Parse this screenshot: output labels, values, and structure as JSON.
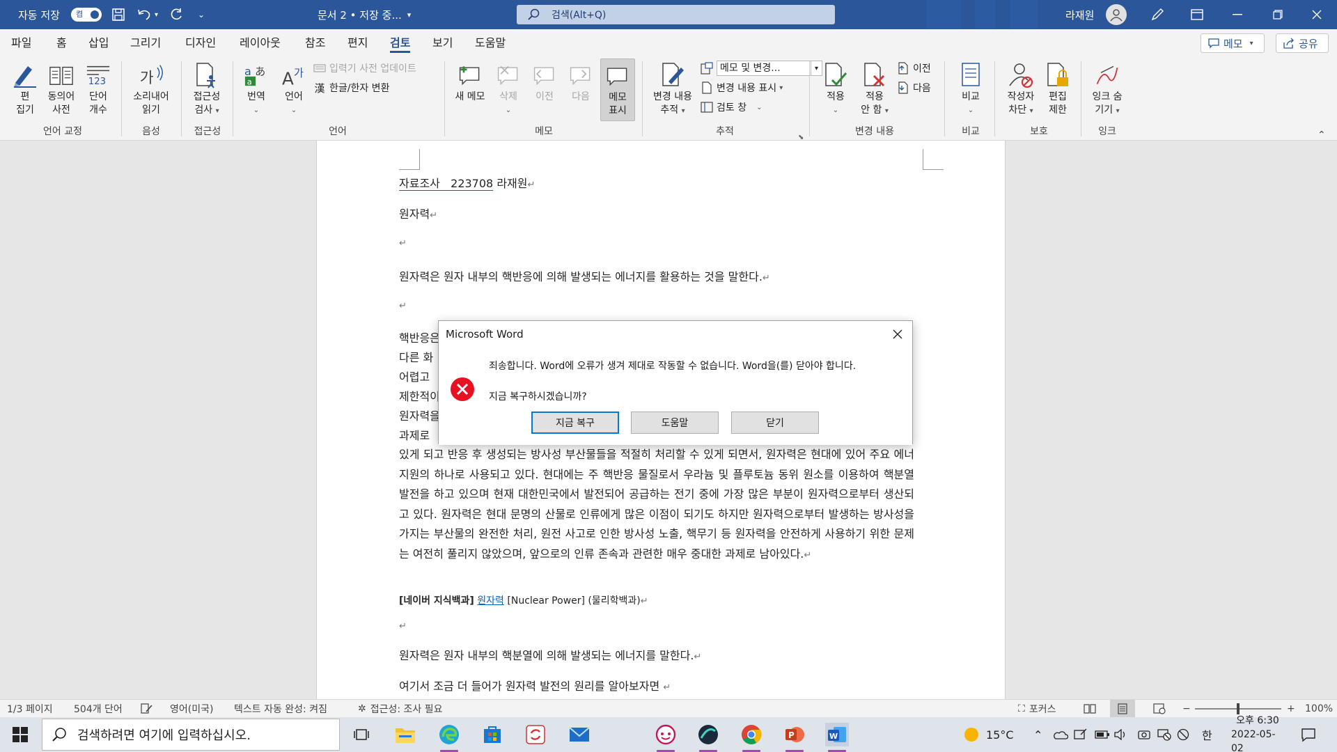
{
  "titlebar": {
    "autosave_label": "자동 저장",
    "autosave_state": "켬",
    "doc_title": "문서 2 • 저장 중...",
    "search_placeholder": "검색(Alt+Q)",
    "user_name": "라재원",
    "bg_color": "#2b579a"
  },
  "menu": {
    "tabs": [
      "파일",
      "홈",
      "삽입",
      "그리기",
      "디자인",
      "레이아웃",
      "참조",
      "편지",
      "검토",
      "보기",
      "도움말"
    ],
    "active_tab": "검토",
    "memo_button": "메모",
    "share_button": "공유"
  },
  "ribbon": {
    "edit_l1": "편",
    "edit_l2": "집기",
    "thesaurus_l1": "동의어",
    "thesaurus_l2": "사전",
    "wordcount_l1": "단어",
    "wordcount_l2": "개수",
    "readaloud_l1": "소리내어",
    "readaloud_l2": "읽기",
    "access_l1": "접근성",
    "access_l2": "검사",
    "translate": "번역",
    "language": "언어",
    "ime_update": "입력기 사전 업데이트",
    "hanja": "한글/한자 변환",
    "new_memo": "새 메모",
    "delete": "삭제",
    "prev": "이전",
    "next": "다음",
    "show_memo_l1": "메모",
    "show_memo_l2": "표시",
    "track_l1": "변경 내용",
    "track_l2": "추적",
    "markup_select": "메모 및 변경...",
    "show_markup": "변경 내용 표시",
    "review_pane": "검토 창",
    "accept_l1": "적용",
    "reject_l1": "적용",
    "reject_l2": "안 함",
    "change_prev": "이전",
    "change_next": "다음",
    "compare": "비교",
    "block_authors_l1": "작성자",
    "block_authors_l2": "차단",
    "restrict_l1": "편집",
    "restrict_l2": "제한",
    "ink_l1": "잉크 숨",
    "ink_l2": "기기",
    "groups": {
      "proofing": "언어 교정",
      "speech": "음성",
      "accessibility": "접근성",
      "language": "언어",
      "comments": "메모",
      "tracking": "추적",
      "changes": "변경 내용",
      "compare": "비교",
      "protect": "보호",
      "ink": "잉크"
    }
  },
  "document": {
    "header_line": "자료조사   223708",
    "header_name": "라재원",
    "title": "원자력",
    "p1": "원자력은 원자 내부의 핵반응에 의해 발생되는 에너지를 활용하는 것을 말한다.",
    "p2_visible": [
      "핵반응은",
      "다른 화",
      "어렵고",
      "제한적이",
      "원자력을",
      "과제로"
    ],
    "p2_rest": "있게 되고 반응 후 생성되는 방사성 부산물들을 적절히 처리할 수 있게 되면서, 원자력은 현대에 있어 주요 에너지원의 하나로 사용되고 있다. 현대에는 주 핵반응 물질로서 우라늄 및 플루토늄 동위 원소를 이용하여 핵분열 발전을 하고 있으며 현재 대한민국에서 발전되어 공급하는 전기 중에 가장 많은 부분이 원자력으로부터 생산되고 있다. 원자력은 현대 문명의 산물로 인류에게 많은 이점이 되기도 하지만 원자력으로부터 발생하는 방사성을 가지는 부산물의 완전한 처리, 원전 사고로 인한 방사성 노출, 핵무기 등 원자력을 안전하게 사용하기 위한 문제는 여전히 풀리지 않았으며, 앞으로의 인류 존속과 관련한 매우 중대한 과제로 남아있다.",
    "source_prefix": "[네이버 지식백과]",
    "source_link": "원자력",
    "source_suffix": "[Nuclear Power] (물리학백과)",
    "p3": "원자력은 원자 내부의 핵분열에 의해 발생되는 에너지를 말한다.",
    "p4": "여기서 조금 더 들어가 원자력 발전의 원리를 알아보자면"
  },
  "dialog": {
    "title": "Microsoft Word",
    "message": "죄송합니다. Word에 오류가 생겨 제대로 작동할 수 없습니다. Word을(를) 닫아야 합니다.",
    "question": "지금 복구하시겠습니까?",
    "btn_recover": "지금 복구",
    "btn_help": "도움말",
    "btn_close": "닫기"
  },
  "statusbar": {
    "page": "1/3 페이지",
    "words": "504개 단어",
    "lang": "영어(미국)",
    "autocomplete": "텍스트 자동 완성: 켜짐",
    "accessibility": "접근성: 조사 필요",
    "focus": "포커스",
    "zoom": "100%"
  },
  "taskbar": {
    "search_placeholder": "검색하려면 여기에 입력하십시오.",
    "weather": "15°C",
    "ime": "한",
    "time": "오후 6:30",
    "date": "2022-05-02"
  }
}
